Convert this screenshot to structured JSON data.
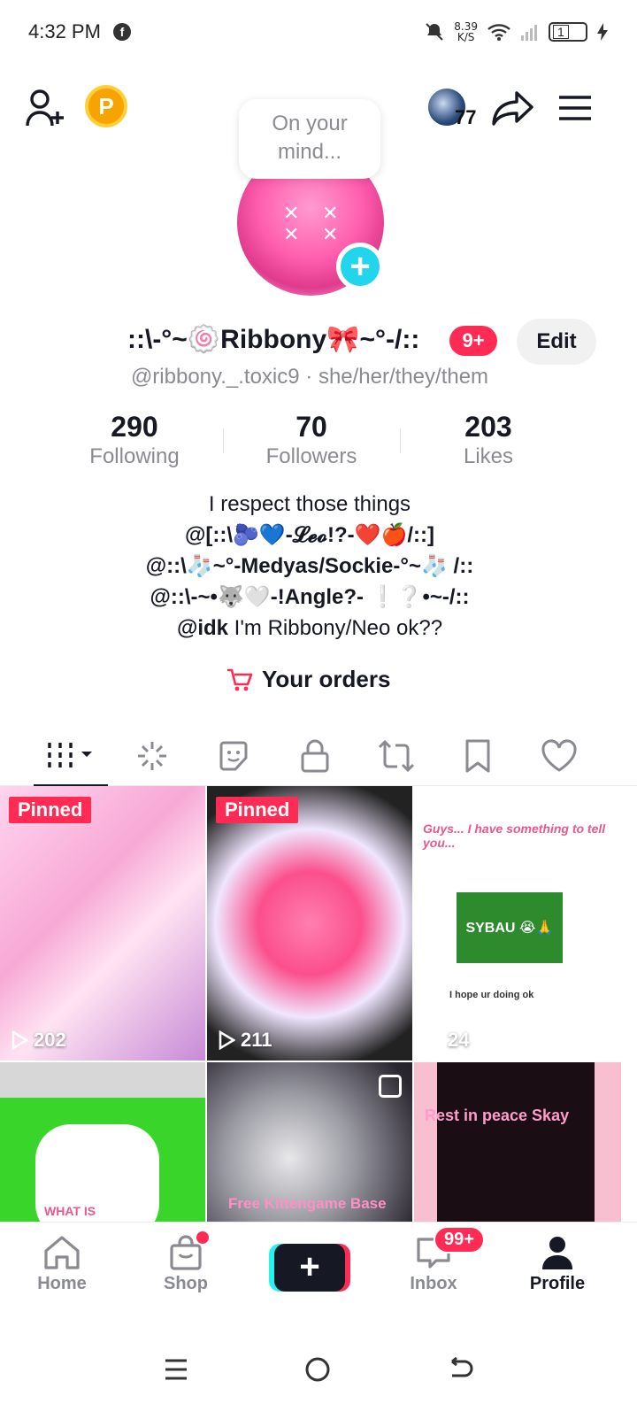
{
  "status_bar": {
    "time": "4:32 PM",
    "speed_value": "8.39",
    "speed_unit": "K/S",
    "battery_level": "1"
  },
  "header": {
    "coin_label": "P",
    "mini_avatar_count": "77",
    "mind_bubble": "On your mind..."
  },
  "profile": {
    "display_name": "::\\-°~🍥Ribbony🎀~°-/::",
    "notification_badge": "9+",
    "edit_label": "Edit",
    "handle": "@ribbony._.toxic9 · she/her/they/them"
  },
  "stats": [
    {
      "value": "290",
      "label": "Following"
    },
    {
      "value": "70",
      "label": "Followers"
    },
    {
      "value": "203",
      "label": "Likes"
    }
  ],
  "bio": {
    "line1": "I respect those things",
    "line2": "@[::\\🫐💙-𝓛𝓮𝓸!?-❤️🍎/::]",
    "line3": "@::\\🧦~°-Medyas/Sockie-°~🧦 /::",
    "line4": "@::\\-~•🐺🤍-!Angle?- ❕❔•~-/::",
    "line5_mention": "@idk",
    "line5_text": " I'm Ribbony/Neo ok??"
  },
  "orders_label": "Your orders",
  "tabs": [
    {
      "icon": "grid-icon",
      "active": true
    },
    {
      "icon": "sparkle-icon",
      "active": false
    },
    {
      "icon": "sticker-icon",
      "active": false
    },
    {
      "icon": "lock-icon",
      "active": false
    },
    {
      "icon": "repost-icon",
      "active": false
    },
    {
      "icon": "bookmark-icon",
      "active": false
    },
    {
      "icon": "heart-icon",
      "active": false
    }
  ],
  "videos": [
    {
      "pinned_label": "Pinned",
      "views": "202"
    },
    {
      "pinned_label": "Pinned",
      "views": "211"
    },
    {
      "views": "24",
      "overlay_text": "Guys... I have something to tell you...",
      "comment_text": "SYBAU 😭🙏",
      "comment_text_2": "I hope ur doing ok"
    },
    {
      "overlay_text": "WHAT IS"
    },
    {
      "overlay_text": "Free Kittengame Base"
    },
    {
      "overlay_text": "Rest in peace Skay"
    }
  ],
  "bottom_nav": {
    "home": "Home",
    "shop": "Shop",
    "inbox": "Inbox",
    "inbox_badge": "99+",
    "profile": "Profile"
  },
  "colors": {
    "accent": "#fe2c55",
    "cyan": "#20d5ec",
    "text_primary": "#161823",
    "text_secondary": "#8a8b91"
  }
}
